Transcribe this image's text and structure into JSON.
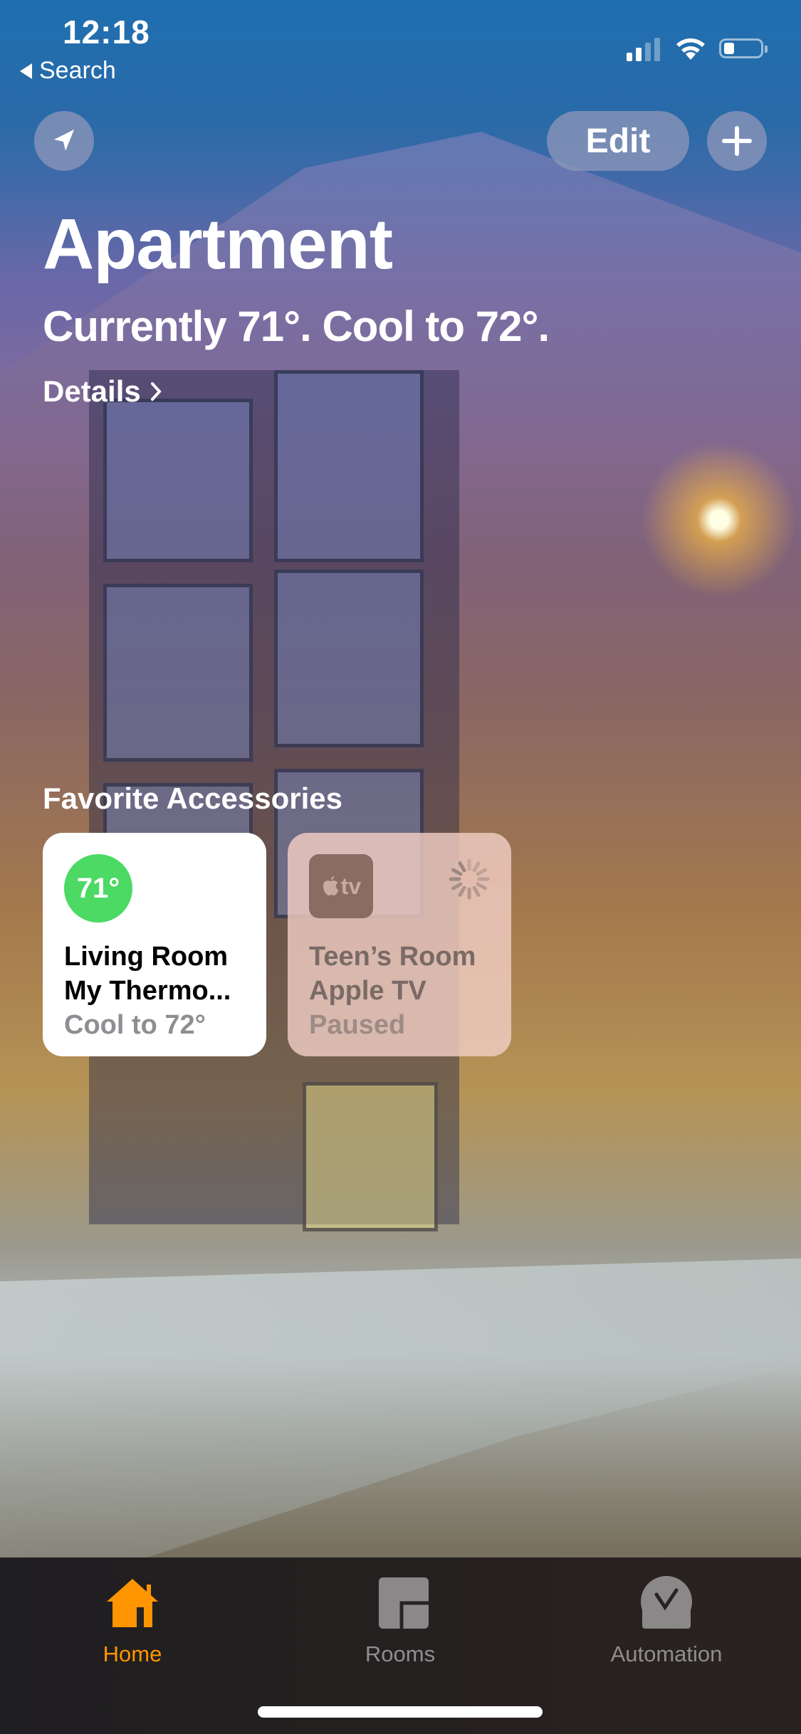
{
  "status_bar": {
    "time": "12:18",
    "back_label": "Search",
    "signal_bars": 2,
    "signal_total": 4,
    "battery_percent": 20
  },
  "toolbar": {
    "location_icon": "location-arrow-icon",
    "edit_label": "Edit",
    "add_icon": "plus-icon"
  },
  "header": {
    "title": "Apartment",
    "subtitle": "Currently 71°. Cool to 72°.",
    "details_label": "Details",
    "details_icon": "chevron-right-icon"
  },
  "favorites": {
    "section_title": "Favorite Accessories",
    "tiles": [
      {
        "badge": "71°",
        "badge_color": "#4cd964",
        "room": "Living Room",
        "name": "My Thermo...",
        "status": "Cool to 72°",
        "active": true
      },
      {
        "icon": "apple-tv-icon",
        "icon_text": "tv",
        "room": "Teen’s Room",
        "name": "Apple TV",
        "status": "Paused",
        "active": false,
        "loading": true
      }
    ]
  },
  "tabbar": {
    "accent_color": "#ff9500",
    "inactive_color": "#8e8e8e",
    "tabs": [
      {
        "label": "Home",
        "icon": "house-icon",
        "selected": true
      },
      {
        "label": "Rooms",
        "icon": "rooms-icon",
        "selected": false
      },
      {
        "label": "Automation",
        "icon": "clock-check-icon",
        "selected": false
      }
    ]
  }
}
